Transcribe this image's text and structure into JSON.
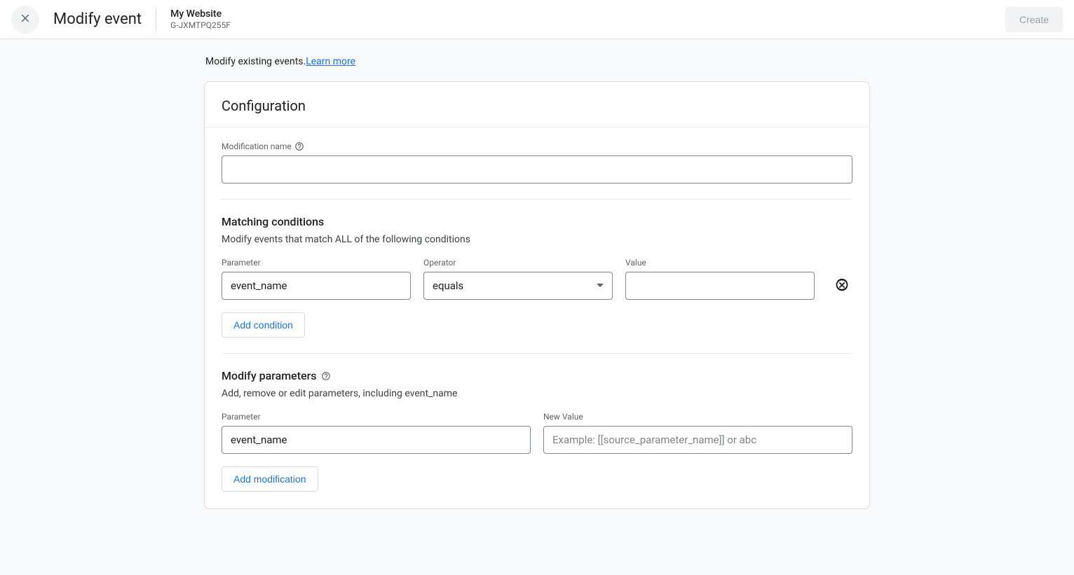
{
  "header": {
    "title": "Modify event",
    "site_name": "My Website",
    "stream_id": "G-JXMTPQ255F",
    "create_label": "Create"
  },
  "intro": {
    "text": "Modify existing events.",
    "link": "Learn more"
  },
  "config": {
    "card_title": "Configuration",
    "mod_name_label": "Modification name",
    "mod_name_value": ""
  },
  "conditions": {
    "title": "Matching conditions",
    "subtitle": "Modify events that match ALL of the following conditions",
    "param_label": "Parameter",
    "operator_label": "Operator",
    "value_label": "Value",
    "row": {
      "parameter": "event_name",
      "operator": "equals",
      "value": ""
    },
    "add_label": "Add condition"
  },
  "modify": {
    "title": "Modify parameters",
    "subtitle": "Add, remove or edit parameters, including event_name",
    "param_label": "Parameter",
    "newval_label": "New Value",
    "row": {
      "parameter": "event_name",
      "new_value": "",
      "placeholder": "Example: [[source_parameter_name]] or abc"
    },
    "add_label": "Add modification"
  }
}
